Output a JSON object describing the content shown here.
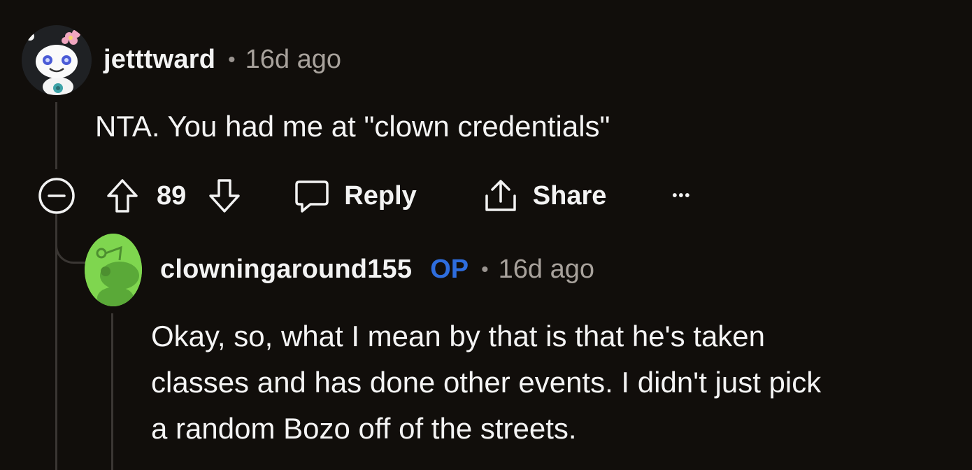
{
  "comment": {
    "username": "jetttward",
    "separator": "•",
    "time": "16d ago",
    "body": "NTA. You had me at \"clown credentials\"",
    "actions": {
      "vote_count": "89",
      "reply_label": "Reply",
      "share_label": "Share",
      "more_label": "•••"
    }
  },
  "reply": {
    "username": "clowningaround155",
    "op_badge": "OP",
    "separator": "•",
    "time": "16d ago",
    "body_lines": [
      "Okay, so, what I mean by that is that he's taken",
      "classes and has done other events. I didn't just pick",
      "a random Bozo off of the streets."
    ]
  },
  "colors": {
    "background": "#110e0b",
    "op_badge": "#2e6dde",
    "reply_avatar": "#7fd64f"
  }
}
